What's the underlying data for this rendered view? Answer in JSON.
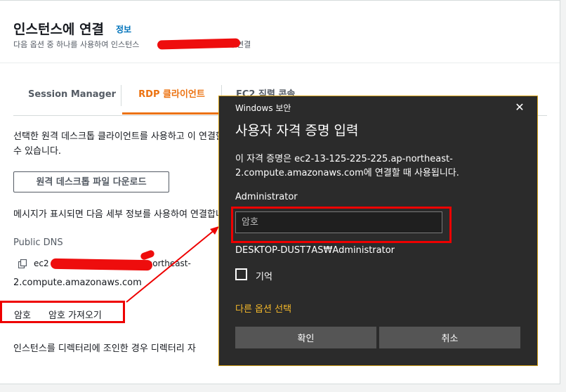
{
  "aws": {
    "title": "인스턴스에 연결",
    "info_link": "정보",
    "subtitle": "다음 옵션 중 하나를 사용하여 인스턴스",
    "subtitle_end": "에 연결",
    "tabs": [
      {
        "label": "Session Manager"
      },
      {
        "label": "RDP 클라이언트"
      },
      {
        "label": "EC2 직렬 콘솔"
      }
    ],
    "rdp_description": "선택한 원격 데스크톱 클라이언트를 사용하고 이 연결할 수 있습니다.",
    "download_button": "원격 데스크톱 파일 다운로드",
    "message_text": "메시지가 표시되면 다음 세부 정보를 사용하여 연결합니다.",
    "public_dns_label": "Public DNS",
    "public_dns_line1_start": "ec2",
    "public_dns_line1_end": "northeast-",
    "public_dns_line2": "2.compute.amazonaws.com",
    "password_label": "암호",
    "get_password_link": "암호 가져오기",
    "domain_text": "인스턴스를 디렉터리에 조인한 경우 디렉터리 자"
  },
  "dialog": {
    "window_title": "Windows 보안",
    "heading": "사용자 자격 증명 입력",
    "description": "이 자격 증명은 ec2-13-125-225-225.ap-northeast-2.compute.amazonaws.com에 연결할 때 사용됩니다.",
    "username": "Administrator",
    "password_placeholder": "암호",
    "account": "DESKTOP-DUST7AS₩Administrator",
    "remember_label": "기억",
    "more_options": "다른 옵션 선택",
    "ok_button": "확인",
    "cancel_button": "취소"
  },
  "colors": {
    "aws_orange": "#ec7211",
    "aws_link": "#0073bb",
    "annotation_red": "#e00000",
    "dialog_bg": "#2b2b2b",
    "dialog_link": "#f5b92b"
  },
  "icons": {
    "copy": "copy-icon",
    "close": "close-icon"
  }
}
